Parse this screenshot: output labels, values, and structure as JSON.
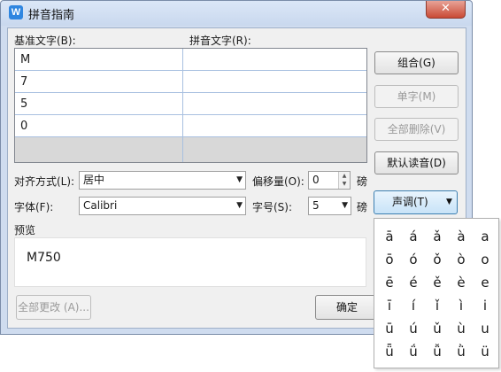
{
  "window": {
    "title": "拼音指南",
    "app_icon": "W"
  },
  "labels": {
    "base_text": "基准文字(B):",
    "pinyin_text": "拼音文字(R):",
    "alignment": "对齐方式(L):",
    "offset": "偏移量(O):",
    "offset_unit": "磅",
    "font": "字体(F):",
    "size": "字号(S):",
    "size_unit": "磅",
    "preview": "预览"
  },
  "grid": {
    "rows": [
      {
        "base": "M",
        "pinyin": ""
      },
      {
        "base": "7",
        "pinyin": ""
      },
      {
        "base": "5",
        "pinyin": ""
      },
      {
        "base": "0",
        "pinyin": ""
      },
      {
        "base": "",
        "pinyin": ""
      }
    ]
  },
  "buttons": {
    "combine": "组合(G)",
    "single": "单字(M)",
    "clear_all": "全部删除(V)",
    "default_reading": "默认读音(D)",
    "tone": "声调(T)",
    "change_all": "全部更改 (A)...",
    "ok": "确定"
  },
  "fields": {
    "alignment_value": "居中",
    "offset_value": "0",
    "font_value": "Calibri",
    "size_value": "5"
  },
  "preview_text": "M750",
  "tones": [
    [
      "ā",
      "á",
      "ǎ",
      "à",
      "a"
    ],
    [
      "ō",
      "ó",
      "ǒ",
      "ò",
      "o"
    ],
    [
      "ē",
      "é",
      "ě",
      "è",
      "e"
    ],
    [
      "ī",
      "í",
      "ǐ",
      "ì",
      "i"
    ],
    [
      "ū",
      "ú",
      "ǔ",
      "ù",
      "u"
    ],
    [
      "ǖ",
      "ǘ",
      "ǚ",
      "ǜ",
      "ü"
    ]
  ]
}
